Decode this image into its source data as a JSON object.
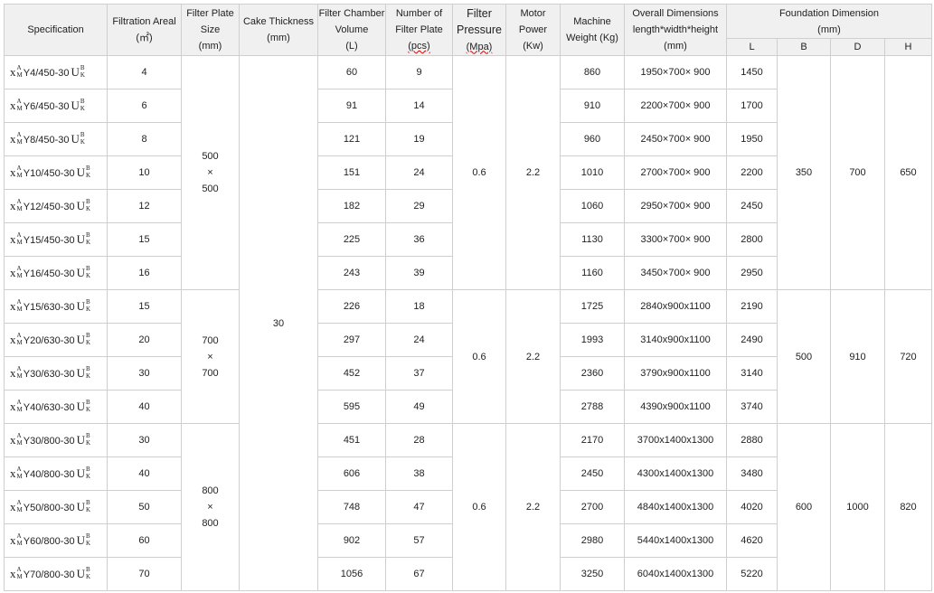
{
  "headers": {
    "spec": "Specification",
    "area": [
      "Filtration Areal",
      "(㎡)"
    ],
    "plate": [
      "Filter Plate",
      "Size",
      "(mm)"
    ],
    "cake": [
      "Cake Thickness",
      "(mm)"
    ],
    "chamber": [
      "Filter Chamber",
      "Volume",
      "(L)"
    ],
    "num": [
      "Number of",
      "Filter Plate",
      "(pcs)"
    ],
    "pressure": [
      "Filter",
      "Pressure",
      "(Mpa)"
    ],
    "motor": [
      "Motor",
      "Power",
      "(Kw)"
    ],
    "weight": [
      "Machine",
      "Weight (Kg)"
    ],
    "overall": [
      "Overall Dimensions",
      "length*width*height",
      "(mm)"
    ],
    "foundation": [
      "Foundation Dimension",
      "(mm)"
    ],
    "L": "L",
    "B": "B",
    "D": "D",
    "H": "H"
  },
  "spec_marks": {
    "x": "x",
    "a": "A",
    "m": "M",
    "u": "U",
    "b": "B",
    "k": "K"
  },
  "cake_thickness": "30",
  "groups": [
    {
      "plate": [
        "500",
        "×",
        "500"
      ],
      "pressure": "0.6",
      "motor": "2.2",
      "B": "350",
      "D": "700",
      "H": "650",
      "rows": [
        {
          "model": "Y4/450-30",
          "area": "4",
          "chamber": "60",
          "num": "9",
          "weight": "860",
          "overall": "1950×700× 900",
          "L": "1450"
        },
        {
          "model": "Y6/450-30",
          "area": "6",
          "chamber": "91",
          "num": "14",
          "weight": "910",
          "overall": "2200×700× 900",
          "L": "1700"
        },
        {
          "model": "Y8/450-30",
          "area": "8",
          "chamber": "121",
          "num": "19",
          "weight": "960",
          "overall": "2450×700× 900",
          "L": "1950"
        },
        {
          "model": "Y10/450-30",
          "area": "10",
          "chamber": "151",
          "num": "24",
          "weight": "1010",
          "overall": "2700×700× 900",
          "L": "2200"
        },
        {
          "model": "Y12/450-30",
          "area": "12",
          "chamber": "182",
          "num": "29",
          "weight": "1060",
          "overall": "2950×700× 900",
          "L": "2450"
        },
        {
          "model": "Y15/450-30",
          "area": "15",
          "chamber": "225",
          "num": "36",
          "weight": "1130",
          "overall": "3300×700× 900",
          "L": "2800"
        },
        {
          "model": "Y16/450-30",
          "area": "16",
          "chamber": "243",
          "num": "39",
          "weight": "1160",
          "overall": "3450×700× 900",
          "L": "2950"
        }
      ]
    },
    {
      "plate": [
        "700",
        "×",
        "700"
      ],
      "pressure": "0.6",
      "motor": "2.2",
      "B": "500",
      "D": "910",
      "H": "720",
      "rows": [
        {
          "model": "Y15/630-30",
          "area": "15",
          "chamber": "226",
          "num": "18",
          "weight": "1725",
          "overall": "2840x900x1100",
          "L": "2190"
        },
        {
          "model": "Y20/630-30",
          "area": "20",
          "chamber": "297",
          "num": "24",
          "weight": "1993",
          "overall": "3140x900x1100",
          "L": "2490"
        },
        {
          "model": "Y30/630-30",
          "area": "30",
          "chamber": "452",
          "num": "37",
          "weight": "2360",
          "overall": "3790x900x1100",
          "L": "3140"
        },
        {
          "model": "Y40/630-30",
          "area": "40",
          "chamber": "595",
          "num": "49",
          "weight": "2788",
          "overall": "4390x900x1100",
          "L": "3740"
        }
      ]
    },
    {
      "plate": [
        "800",
        "×",
        "800"
      ],
      "pressure": "0.6",
      "motor": "2.2",
      "B": "600",
      "D": "1000",
      "H": "820",
      "rows": [
        {
          "model": "Y30/800-30",
          "area": "30",
          "chamber": "451",
          "num": "28",
          "weight": "2170",
          "overall": "3700x1400x1300",
          "L": "2880"
        },
        {
          "model": "Y40/800-30",
          "area": "40",
          "chamber": "606",
          "num": "38",
          "weight": "2450",
          "overall": "4300x1400x1300",
          "L": "3480"
        },
        {
          "model": "Y50/800-30",
          "area": "50",
          "chamber": "748",
          "num": "47",
          "weight": "2700",
          "overall": "4840x1400x1300",
          "L": "4020"
        },
        {
          "model": "Y60/800-30",
          "area": "60",
          "chamber": "902",
          "num": "57",
          "weight": "2980",
          "overall": "5440x1400x1300",
          "L": "4620"
        },
        {
          "model": "Y70/800-30",
          "area": "70",
          "chamber": "1056",
          "num": "67",
          "weight": "3250",
          "overall": "6040x1400x1300",
          "L": "5220"
        }
      ]
    }
  ]
}
